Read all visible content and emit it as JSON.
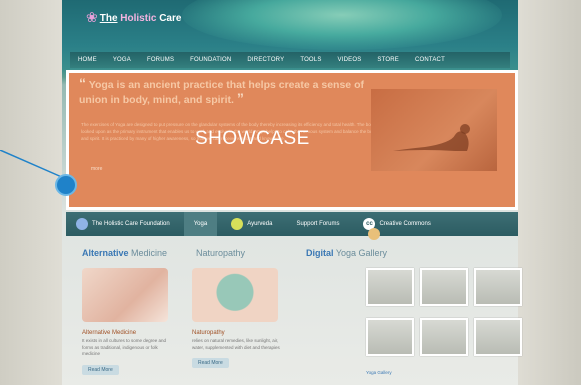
{
  "site": {
    "logo": {
      "prefix": "The",
      "highlight": "Holistic",
      "suffix": "Care"
    },
    "nav": [
      "HOME",
      "YOGA",
      "FORUMS",
      "FOUNDATION",
      "DIRECTORY",
      "TOOLS",
      "VIDEOS",
      "STORE",
      "CONTACT"
    ]
  },
  "showcase": {
    "quote": "Yoga is an ancient practice that helps create a sense of union in body, mind, and spirit.",
    "description": "The exercises of Yoga are designed to put pressure on the glandular systems of the body thereby increasing its efficiency and total health. The body is looked upon as the primary instrument that enables us to work and evolve in the world. Yoga helps to calm the nervous system and balance the body, mind and spirit. It is practiced by many of higher awareness, so that we can receive wisdom and knowledge.",
    "overlay_title": "SHOWCASE",
    "more": "more"
  },
  "tabs": [
    {
      "label": "The Holistic Care Foundation"
    },
    {
      "label": "Yoga"
    },
    {
      "label": "Ayurveda"
    },
    {
      "label": "Support Forums"
    },
    {
      "label": "Creative Commons",
      "icon_text": "cc"
    }
  ],
  "content": {
    "alt_med_title_bold": "Alternative",
    "alt_med_title_rest": "Medicine",
    "naturopathy_title": "Naturopathy",
    "gallery_title_bold": "Digital",
    "gallery_title_rest": "Yoga Gallery",
    "cards": [
      {
        "heading": "Alternative Medicine",
        "text": "It exists in all cultures to some degree and forms as traditional, indigenous or folk medicine",
        "button": "Read More"
      },
      {
        "heading": "Naturopathy",
        "text": "relies on natural remedies, like sunlight, air, water, supplemented with diet and therapies",
        "button": "Read More"
      }
    ],
    "gallery_label": "Yoga Gallery"
  },
  "colors": {
    "accent": "#1f82c9",
    "overlay": "#e0885b"
  }
}
